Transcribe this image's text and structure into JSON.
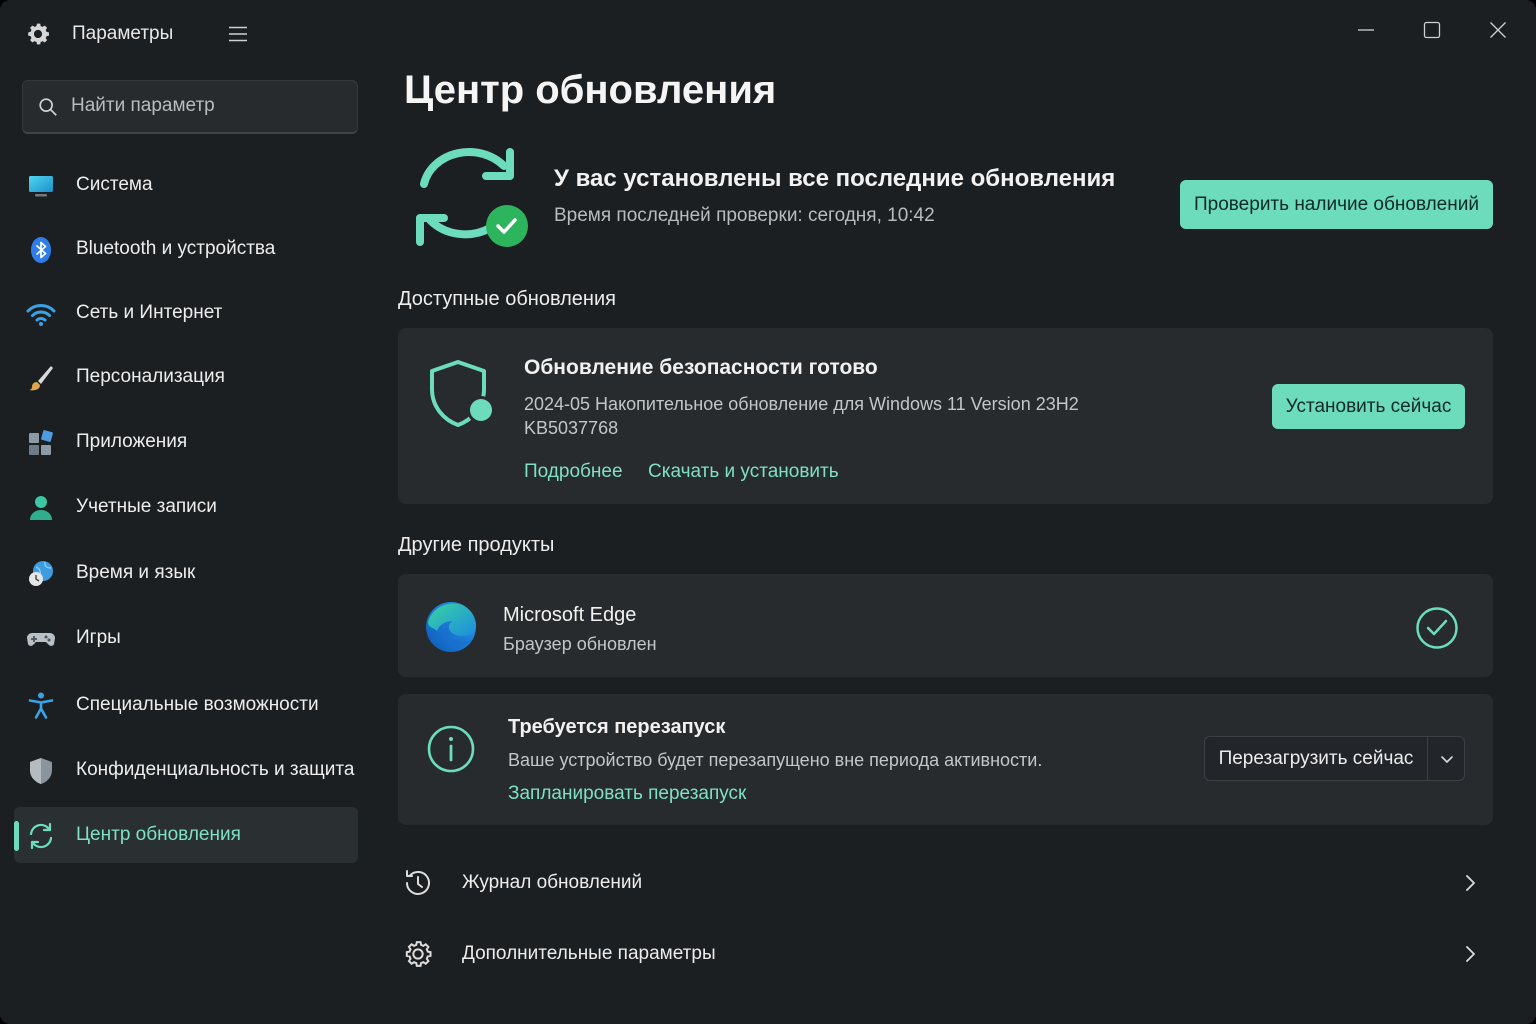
{
  "app": {
    "title": "Параметры"
  },
  "search": {
    "placeholder": "Найти параметр"
  },
  "sidebar": {
    "items": [
      {
        "label": "Система",
        "icon": "monitor-icon"
      },
      {
        "label": "Bluetooth и устройства",
        "icon": "bluetooth-icon"
      },
      {
        "label": "Сеть и Интернет",
        "icon": "wifi-icon"
      },
      {
        "label": "Персонализация",
        "icon": "brush-icon"
      },
      {
        "label": "Приложения",
        "icon": "apps-icon"
      },
      {
        "label": "Учетные записи",
        "icon": "person-icon"
      },
      {
        "label": "Время и язык",
        "icon": "globe-clock-icon"
      },
      {
        "label": "Игры",
        "icon": "gamepad-icon"
      },
      {
        "label": "Специальные возможности",
        "icon": "accessibility-icon"
      },
      {
        "label": "Конфиденциальность и защита",
        "icon": "shield-icon"
      },
      {
        "label": "Центр обновления",
        "icon": "sync-icon",
        "active": true
      }
    ]
  },
  "main": {
    "title": "Центр обновления",
    "status": {
      "title": "У вас установлены все последние обновления",
      "subtitle": "Время последней проверки: сегодня, 10:42",
      "check_button": "Проверить наличие обновлений"
    },
    "available_title": "Доступные обновления",
    "security_update": {
      "title": "Обновление безопасности готово",
      "desc_line1": "2024-05 Накопительное обновление для Windows 11 Version 23H2",
      "desc_line2": "KB5037768",
      "link_more": "Подробнее",
      "link_download": "Скачать и установить",
      "install_button": "Установить сейчас"
    },
    "other_title": "Другие продукты",
    "edge": {
      "title": "Microsoft Edge",
      "subtitle": "Браузер обновлен"
    },
    "restart": {
      "title": "Требуется перезапуск",
      "subtitle": "Ваше устройство будет перезапущено вне периода активности.",
      "link_schedule": "Запланировать перезапуск",
      "restart_button": "Перезагрузить сейчас"
    },
    "rows": [
      {
        "label": "Журнал обновлений",
        "icon": "history-icon"
      },
      {
        "label": "Дополнительные параметры",
        "icon": "gear-icon"
      }
    ]
  },
  "colors": {
    "accent": "#6cdcbc",
    "background": "#1c1f22",
    "card": "#272b2e"
  }
}
